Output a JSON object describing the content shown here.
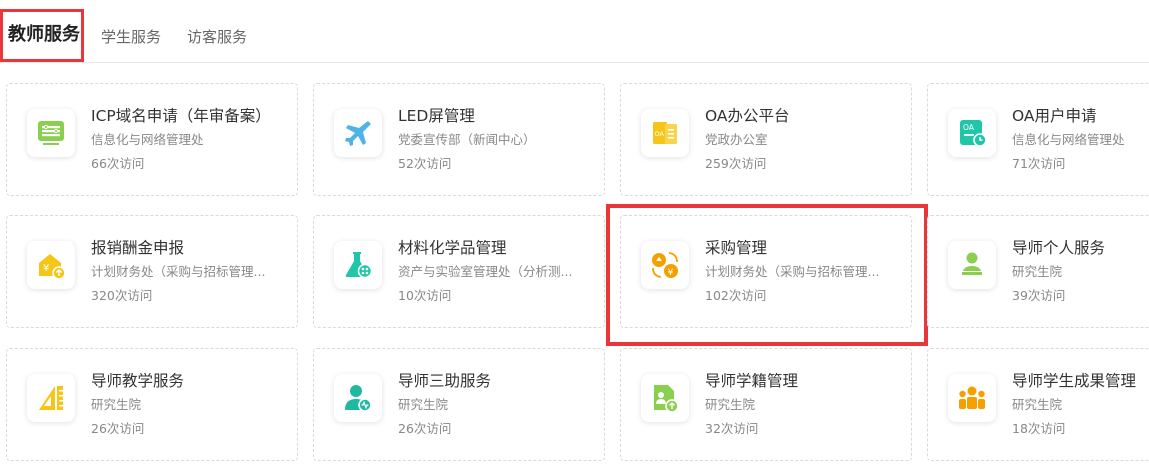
{
  "tabs": [
    {
      "label": "教师服务",
      "active": true
    },
    {
      "label": "学生服务",
      "active": false
    },
    {
      "label": "访客服务",
      "active": false
    }
  ],
  "colors": {
    "highlight": "#e8363b"
  },
  "cards": [
    {
      "title": "ICP域名申请（年审备案）",
      "dept": "信息化与网络管理处",
      "visits": "66次访问",
      "icon": "server-icon"
    },
    {
      "title": "LED屏管理",
      "dept": "党委宣传部（新闻中心）",
      "visits": "52次访问",
      "icon": "airplane-icon"
    },
    {
      "title": "OA办公平台",
      "dept": "党政办公室",
      "visits": "259次访问",
      "icon": "oa-document-icon"
    },
    {
      "title": "OA用户申请",
      "dept": "信息化与网络管理处",
      "visits": "71次访问",
      "icon": "oa-user-clock-icon"
    },
    {
      "title": "报销酬金申报",
      "dept": "计划财务处（采购与招标管理...",
      "visits": "320次访问",
      "icon": "yuan-house-icon"
    },
    {
      "title": "材料化学品管理",
      "dept": "资产与实验室管理处（分析测...",
      "visits": "10次访问",
      "icon": "flask-icon"
    },
    {
      "title": "采购管理",
      "dept": "计划财务处（采购与招标管理...",
      "visits": "102次访问",
      "icon": "purchase-exchange-icon"
    },
    {
      "title": "导师个人服务",
      "dept": "研究生院",
      "visits": "39次访问",
      "icon": "teacher-board-icon"
    },
    {
      "title": "导师教学服务",
      "dept": "研究生院",
      "visits": "26次访问",
      "icon": "ruler-triangle-icon"
    },
    {
      "title": "导师三助服务",
      "dept": "研究生院",
      "visits": "26次访问",
      "icon": "doctor-user-icon"
    },
    {
      "title": "导师学籍管理",
      "dept": "研究生院",
      "visits": "32次访问",
      "icon": "student-record-icon"
    },
    {
      "title": "导师学生成果管理",
      "dept": "研究生院",
      "visits": "18次访问",
      "icon": "team-people-icon"
    }
  ]
}
